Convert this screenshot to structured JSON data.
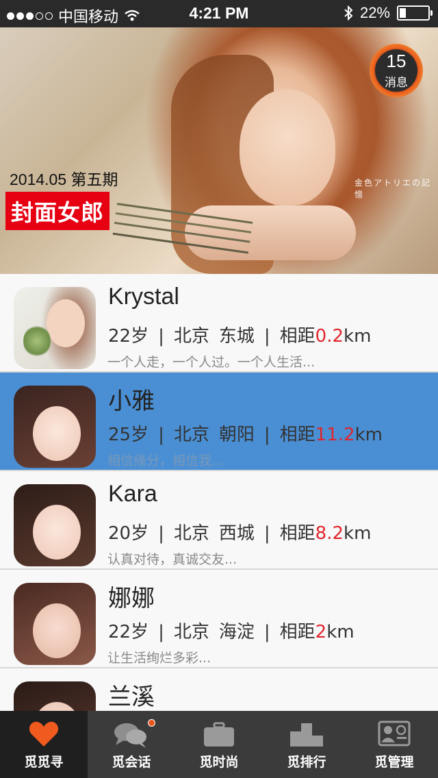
{
  "status": {
    "carrier": "中国移动",
    "time": "4:21 PM",
    "battery": "22%"
  },
  "banner": {
    "issue": "2014.05 第五期",
    "cover_label": "封面女郎",
    "watermark": "金色アトリエの記憶",
    "messages": {
      "count": "15",
      "label": "消息"
    }
  },
  "list": [
    {
      "name": "Krystal",
      "age": "22岁",
      "city": "北京",
      "district": "东城",
      "dist_prefix": "相距",
      "dist_value": "0.2",
      "dist_unit": "km",
      "signature": "一个人走，一个人过。一个人生活..."
    },
    {
      "name": "小雅",
      "age": "25岁",
      "city": "北京",
      "district": "朝阳",
      "dist_prefix": "相距",
      "dist_value": "11.2",
      "dist_unit": "km",
      "signature": "相信缘分，相信我..."
    },
    {
      "name": "Kara",
      "age": "20岁",
      "city": "北京",
      "district": "西城",
      "dist_prefix": "相距",
      "dist_value": "8.2",
      "dist_unit": "km",
      "signature": "认真对待，真诚交友..."
    },
    {
      "name": "娜娜",
      "age": "22岁",
      "city": "北京",
      "district": "海淀",
      "dist_prefix": "相距",
      "dist_value": "2",
      "dist_unit": "km",
      "signature": "让生活绚烂多彩..."
    },
    {
      "name": "兰溪"
    }
  ],
  "tabs": [
    {
      "label": "觅觅寻",
      "icon": "heart-icon"
    },
    {
      "label": "觅会话",
      "icon": "chat-bubbles-icon"
    },
    {
      "label": "觅时尚",
      "icon": "briefcase-icon"
    },
    {
      "label": "觅排行",
      "icon": "podium-icon"
    },
    {
      "label": "觅管理",
      "icon": "contact-card-icon"
    }
  ],
  "colors": {
    "selected_row": "#4a8fd4",
    "distance_highlight": "#e0262c",
    "active_tab_icon": "#f05a1e",
    "cover_label_bg": "#e60012"
  }
}
